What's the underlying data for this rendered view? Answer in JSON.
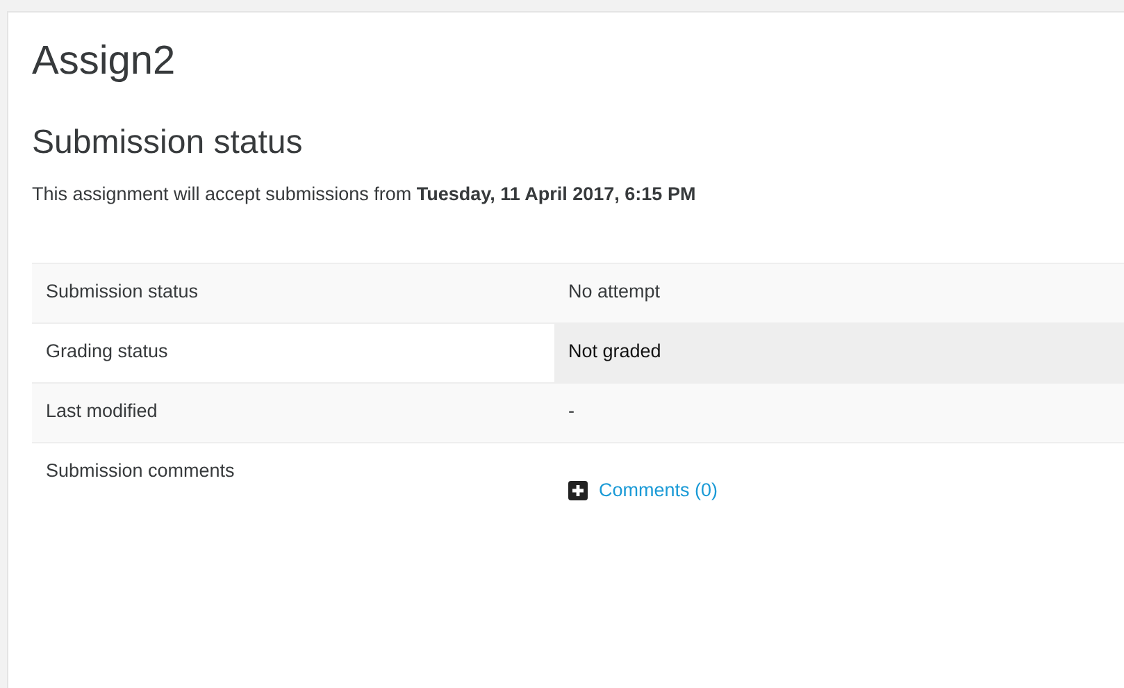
{
  "title": "Assign2",
  "section_heading": "Submission status",
  "intro": "This assignment will accept submissions from **Tuesday, 11 April 2017, 6:15 PM**",
  "rows": [
    {
      "label": "Submission status",
      "kind": "text",
      "value": "No attempt",
      "highlighted": false
    },
    {
      "label": "Grading status",
      "kind": "text",
      "value": "Not graded",
      "highlighted": true
    },
    {
      "label": "Last modified",
      "kind": "text",
      "value": "-",
      "highlighted": false
    },
    {
      "label": "Submission comments",
      "kind": "comments",
      "value": "Comments (0)"
    }
  ]
}
